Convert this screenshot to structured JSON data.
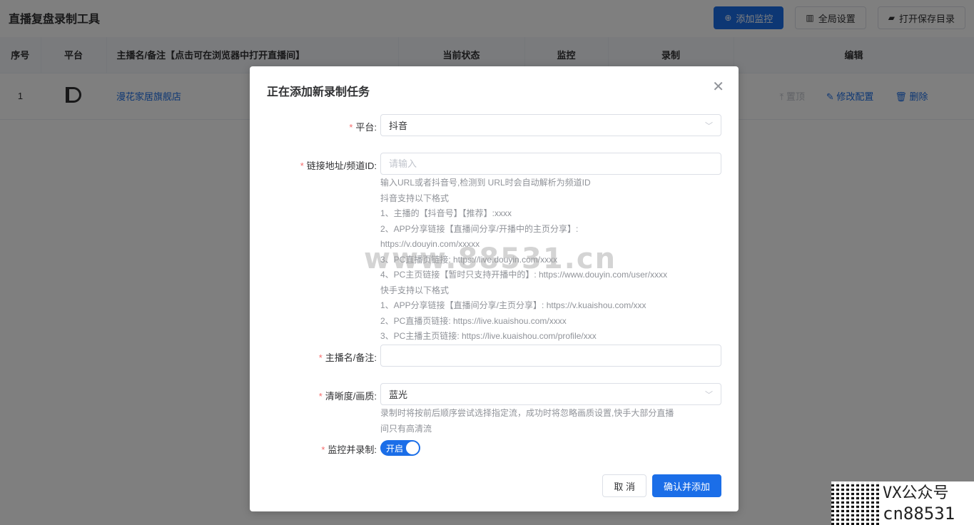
{
  "app": {
    "title": "直播复盘录制工具",
    "buttons": {
      "add_monitor": "添加监控",
      "global_settings": "全局设置",
      "open_save_dir": "打开保存目录"
    }
  },
  "table": {
    "headers": [
      "序号",
      "平台",
      "主播名/备注【点击可在浏览器中打开直播间】",
      "当前状态",
      "监控",
      "录制",
      "编辑"
    ],
    "rows": [
      {
        "index": "1",
        "platform_icon": "douyin-logo",
        "name": "漫花家居旗舰店",
        "actions": {
          "pin": "置顶",
          "edit": "修改配置",
          "delete": "删除"
        }
      }
    ]
  },
  "dialog": {
    "title": "正在添加新录制任务",
    "platform": {
      "label": "平台:",
      "value": "抖音"
    },
    "url": {
      "label": "链接地址/频道ID:",
      "placeholder": "请输入",
      "help": [
        "输入URL或者抖音号,检测到 URL时会自动解析为频道ID",
        "抖音支持以下格式",
        "1、主播的【抖音号】【推荐】:xxxx",
        "2、APP分享链接【直播间分享/开播中的主页分享】:",
        "https://v.douyin.com/xxxxx",
        "3、PC直播页链接: https://live.douyin.com/xxxx",
        "4、PC主页链接【暂时只支持开播中的】: https://www.douyin.com/user/xxxx",
        "快手支持以下格式",
        "1、APP分享链接【直播间分享/主页分享】: https://v.kuaishou.com/xxx",
        "2、PC直播页链接: https://live.kuaishou.com/xxxx",
        "3、PC主播主页链接: https://live.kuaishou.com/profile/xxx"
      ]
    },
    "streamer": {
      "label": "主播名/备注:",
      "value": ""
    },
    "quality": {
      "label": "清晰度/画质:",
      "value": "蓝光",
      "help": [
        "录制时将按前后顺序尝试选择指定流，成功时将忽略画质设置,快手大部分直播",
        "间只有高清流"
      ]
    },
    "monitor": {
      "label": "监控并录制:",
      "switch_text": "开启"
    },
    "footer": {
      "cancel": "取 消",
      "confirm": "确认并添加"
    }
  },
  "watermark": "www.88531.cn",
  "corner": {
    "line1": "VX公众号",
    "line2": "cn88531"
  }
}
